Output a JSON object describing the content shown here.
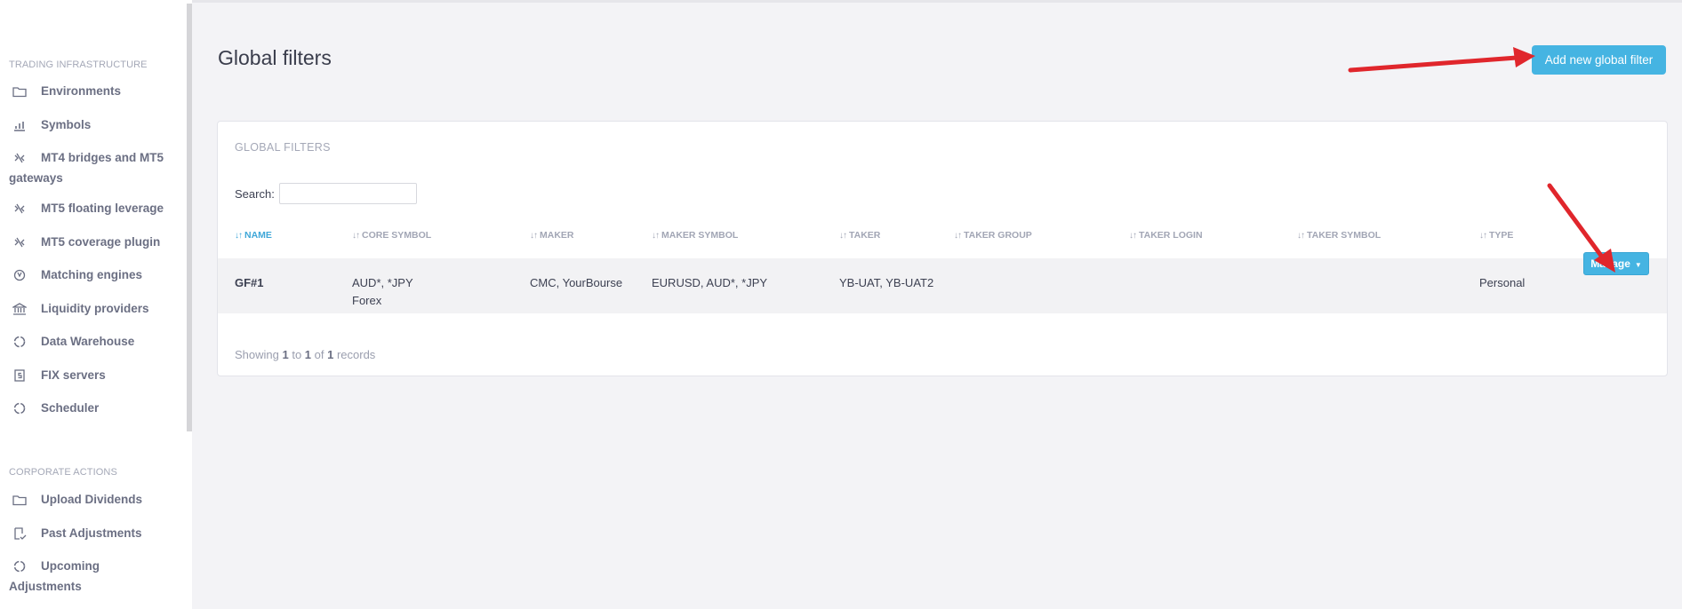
{
  "sidebar": {
    "sections": [
      {
        "label": "TRADING INFRASTRUCTURE",
        "items": [
          {
            "label": "Environments",
            "icon": "folder-icon"
          },
          {
            "label": "Symbols",
            "icon": "bar-chart-icon"
          },
          {
            "label": "MT4 bridges and MT5",
            "label2": "gateways",
            "icon": "bridge-icon"
          },
          {
            "label": "MT5 floating leverage",
            "icon": "bridge-icon"
          },
          {
            "label": "MT5 coverage plugin",
            "icon": "bridge-icon"
          },
          {
            "label": "Matching engines",
            "icon": "engine-icon"
          },
          {
            "label": "Liquidity providers",
            "icon": "bank-icon"
          },
          {
            "label": "Data Warehouse",
            "icon": "circle-icon"
          },
          {
            "label": "FIX servers",
            "icon": "document-s-icon"
          },
          {
            "label": "Scheduler",
            "icon": "circle-icon"
          }
        ]
      },
      {
        "label": "CORPORATE ACTIONS",
        "items": [
          {
            "label": "Upload Dividends",
            "icon": "folder-icon"
          },
          {
            "label": "Past Adjustments",
            "icon": "checklist-icon"
          },
          {
            "label": "Upcoming Adjustments",
            "icon": "circle-icon"
          }
        ]
      }
    ]
  },
  "header": {
    "title": "Global filters",
    "add_button": "Add new global filter"
  },
  "card": {
    "title": "GLOBAL FILTERS",
    "search_label": "Search:",
    "search_value": "",
    "columns": [
      "NAME",
      "CORE SYMBOL",
      "MAKER",
      "MAKER SYMBOL",
      "TAKER",
      "TAKER GROUP",
      "TAKER LOGIN",
      "TAKER SYMBOL",
      "TYPE"
    ],
    "rows": [
      {
        "name": "GF#1",
        "core_symbol_1": "AUD*, *JPY",
        "core_symbol_2": "Forex",
        "maker": "CMC, YourBourse",
        "maker_symbol": "EURUSD, AUD*, *JPY",
        "taker": "YB-UAT, YB-UAT2",
        "taker_group": "",
        "taker_login": "",
        "taker_symbol": "",
        "type": "Personal",
        "action": "Manage"
      }
    ],
    "info": {
      "prefix": "Showing ",
      "from": "1",
      "to_word": " to ",
      "to": "1",
      "of_word": " of ",
      "total": "1",
      "suffix": " records"
    }
  },
  "colors": {
    "accent": "#45b4e2",
    "annotation_arrow": "#e0262c",
    "sidebar_bg": "#ffffff",
    "page_bg": "#f3f3f6"
  }
}
